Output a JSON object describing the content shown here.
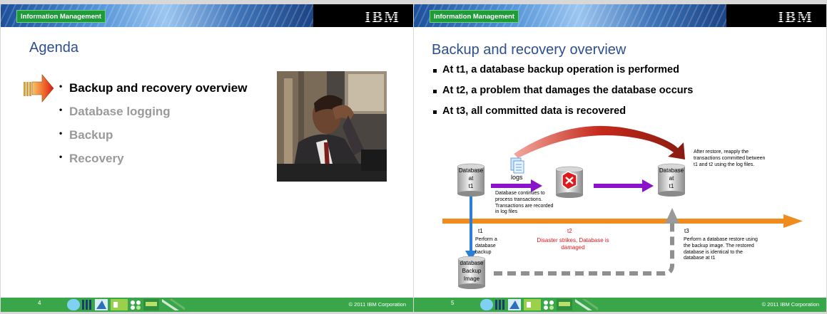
{
  "slide1": {
    "header_badge": "Information Management",
    "ibm_logo": "IBM",
    "title": "Agenda",
    "agenda_items": [
      {
        "label": "Backup and recovery overview",
        "active": true
      },
      {
        "label": "Database logging",
        "active": false
      },
      {
        "label": "Backup",
        "active": false
      },
      {
        "label": "Recovery",
        "active": false
      }
    ],
    "footer": {
      "page": "4",
      "copyright": "© 2011 IBM Corporation"
    }
  },
  "slide2": {
    "header_badge": "Information Management",
    "ibm_logo": "IBM",
    "title": "Backup and recovery overview",
    "bullets": [
      "At t1, a database backup operation is performed",
      "At t2, a problem that damages the database occurs",
      "At t3, all committed data is recovered"
    ],
    "diagram": {
      "db_t1": [
        "Database",
        "at",
        "t1"
      ],
      "db_t3": [
        "Database",
        "at",
        "t1"
      ],
      "logs_label": "logs",
      "continue_note": "Database continues to process transactions. Transactions are recorded in log files",
      "after_restore_note": "After restore, reapply the transactions committed between t1 and t2 using the log files.",
      "t1_label": "t1",
      "t1_note": "Perform a database backup",
      "t2_label": "t2",
      "t2_note": "Disaster strikes, Database is damaged",
      "t3_label": "t3",
      "t3_note": "Perform a database restore using the backup image. The restored database is identical to the database at t1",
      "backup_image": [
        "database",
        "Backup",
        "Image"
      ]
    },
    "footer": {
      "page": "5",
      "copyright": "© 2011 IBM Corporation"
    }
  },
  "colors": {
    "title_blue": "#2d4f8e",
    "footer_green": "#3aa64a",
    "timeline_orange": "#f08c1e",
    "log_purple": "#8a12c8",
    "alert_red": "#e0191e",
    "curve_red": "#b11a12"
  }
}
